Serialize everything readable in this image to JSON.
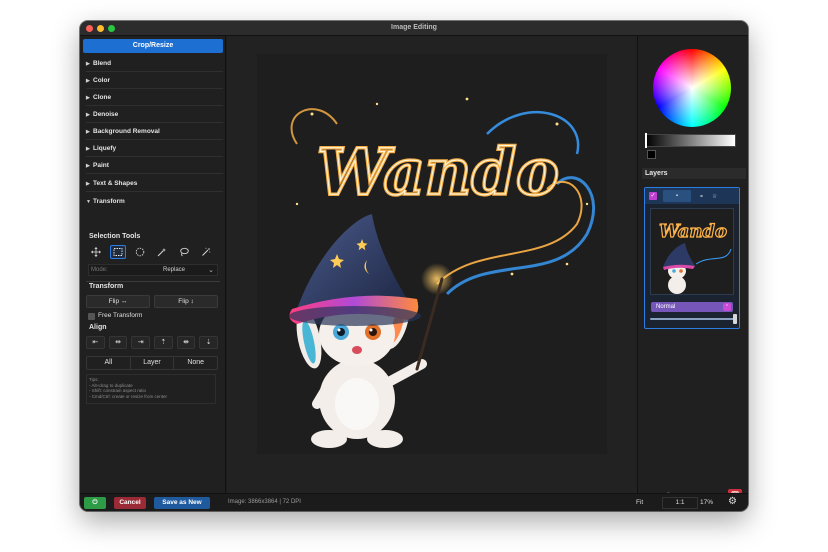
{
  "window": {
    "title": "Image Editing"
  },
  "left_panel": {
    "crop_resize": "Crop/Resize",
    "sections": [
      {
        "label": "Blend",
        "expanded": false
      },
      {
        "label": "Color",
        "expanded": false
      },
      {
        "label": "Clone",
        "expanded": false
      },
      {
        "label": "Denoise",
        "expanded": false
      },
      {
        "label": "Background Removal",
        "expanded": false
      },
      {
        "label": "Liquefy",
        "expanded": false
      },
      {
        "label": "Paint",
        "expanded": false
      },
      {
        "label": "Text & Shapes",
        "expanded": false
      },
      {
        "label": "Transform",
        "expanded": true
      }
    ],
    "arrow_collapsed": "▶",
    "arrow_expanded": "▼",
    "selection_tools": {
      "title": "Selection Tools",
      "tools": [
        "move-icon",
        "rectangle-select-icon",
        "ellipse-select-icon",
        "magic-wand-icon",
        "lasso-icon",
        "wand-sparkle-icon"
      ],
      "active": "rectangle-select-icon"
    },
    "mode": {
      "label": "Mode:",
      "value": "Replace"
    },
    "transform": {
      "title": "Transform",
      "flip_h": "Flip ↔",
      "flip_v": "Flip ↕",
      "free_transform": "Free Transform",
      "free_transform_checked": false
    },
    "align": {
      "title": "Align",
      "buttons": [
        "⇤",
        "⇹",
        "⇥",
        "⇡",
        "⇼",
        "⇣"
      ]
    },
    "select_buttons": [
      "All",
      "Layer",
      "None"
    ],
    "tips": [
      "Tips:",
      "- Alt+drag to duplicate",
      "- Shift: constrain aspect ratio",
      "- Cmd/Ctrl: create or resize from center"
    ]
  },
  "canvas": {
    "artwork_text": "Wando"
  },
  "right_panel": {
    "layers_title": "Layers",
    "layer": {
      "visible_check": "✓",
      "tab_label": "▪",
      "blend_mode": "Normal",
      "blend_chevron": "⌃",
      "opacity": 1.0,
      "thumbnail_text": "Wando"
    },
    "actions": [
      "+",
      "⟳",
      "⧉",
      "⧈",
      "🗑"
    ]
  },
  "statusbar": {
    "power_label": "⏻",
    "cancel_label": "Cancel",
    "save_label": "Save as New",
    "image_info": "Image: 3866x3864  |  72 DPI",
    "fit_label": "Fit",
    "one_to_one": "1:1",
    "zoom": "17%",
    "gear": "⚙"
  },
  "colors": {
    "accent_blue": "#1d6fd1",
    "cancel_red": "#9a2a35",
    "power_green": "#2e9c46",
    "delete_red": "#c9303c",
    "blend_purple": "#7656b8"
  }
}
